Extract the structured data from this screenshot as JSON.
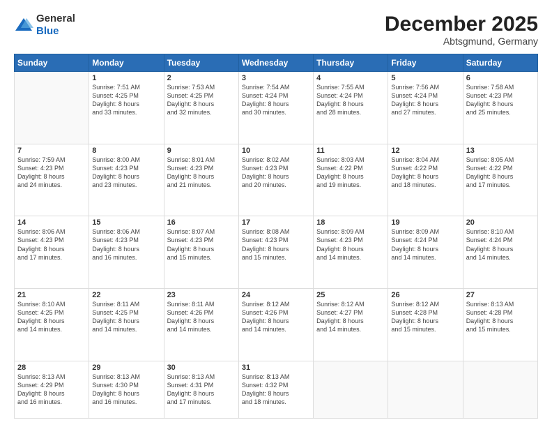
{
  "logo": {
    "general": "General",
    "blue": "Blue"
  },
  "header": {
    "month": "December 2025",
    "location": "Abtsgmund, Germany"
  },
  "days_of_week": [
    "Sunday",
    "Monday",
    "Tuesday",
    "Wednesday",
    "Thursday",
    "Friday",
    "Saturday"
  ],
  "weeks": [
    [
      {
        "day": "",
        "info": ""
      },
      {
        "day": "1",
        "info": "Sunrise: 7:51 AM\nSunset: 4:25 PM\nDaylight: 8 hours\nand 33 minutes."
      },
      {
        "day": "2",
        "info": "Sunrise: 7:53 AM\nSunset: 4:25 PM\nDaylight: 8 hours\nand 32 minutes."
      },
      {
        "day": "3",
        "info": "Sunrise: 7:54 AM\nSunset: 4:24 PM\nDaylight: 8 hours\nand 30 minutes."
      },
      {
        "day": "4",
        "info": "Sunrise: 7:55 AM\nSunset: 4:24 PM\nDaylight: 8 hours\nand 28 minutes."
      },
      {
        "day": "5",
        "info": "Sunrise: 7:56 AM\nSunset: 4:24 PM\nDaylight: 8 hours\nand 27 minutes."
      },
      {
        "day": "6",
        "info": "Sunrise: 7:58 AM\nSunset: 4:23 PM\nDaylight: 8 hours\nand 25 minutes."
      }
    ],
    [
      {
        "day": "7",
        "info": "Sunrise: 7:59 AM\nSunset: 4:23 PM\nDaylight: 8 hours\nand 24 minutes."
      },
      {
        "day": "8",
        "info": "Sunrise: 8:00 AM\nSunset: 4:23 PM\nDaylight: 8 hours\nand 23 minutes."
      },
      {
        "day": "9",
        "info": "Sunrise: 8:01 AM\nSunset: 4:23 PM\nDaylight: 8 hours\nand 21 minutes."
      },
      {
        "day": "10",
        "info": "Sunrise: 8:02 AM\nSunset: 4:23 PM\nDaylight: 8 hours\nand 20 minutes."
      },
      {
        "day": "11",
        "info": "Sunrise: 8:03 AM\nSunset: 4:22 PM\nDaylight: 8 hours\nand 19 minutes."
      },
      {
        "day": "12",
        "info": "Sunrise: 8:04 AM\nSunset: 4:22 PM\nDaylight: 8 hours\nand 18 minutes."
      },
      {
        "day": "13",
        "info": "Sunrise: 8:05 AM\nSunset: 4:22 PM\nDaylight: 8 hours\nand 17 minutes."
      }
    ],
    [
      {
        "day": "14",
        "info": "Sunrise: 8:06 AM\nSunset: 4:23 PM\nDaylight: 8 hours\nand 17 minutes."
      },
      {
        "day": "15",
        "info": "Sunrise: 8:06 AM\nSunset: 4:23 PM\nDaylight: 8 hours\nand 16 minutes."
      },
      {
        "day": "16",
        "info": "Sunrise: 8:07 AM\nSunset: 4:23 PM\nDaylight: 8 hours\nand 15 minutes."
      },
      {
        "day": "17",
        "info": "Sunrise: 8:08 AM\nSunset: 4:23 PM\nDaylight: 8 hours\nand 15 minutes."
      },
      {
        "day": "18",
        "info": "Sunrise: 8:09 AM\nSunset: 4:23 PM\nDaylight: 8 hours\nand 14 minutes."
      },
      {
        "day": "19",
        "info": "Sunrise: 8:09 AM\nSunset: 4:24 PM\nDaylight: 8 hours\nand 14 minutes."
      },
      {
        "day": "20",
        "info": "Sunrise: 8:10 AM\nSunset: 4:24 PM\nDaylight: 8 hours\nand 14 minutes."
      }
    ],
    [
      {
        "day": "21",
        "info": "Sunrise: 8:10 AM\nSunset: 4:25 PM\nDaylight: 8 hours\nand 14 minutes."
      },
      {
        "day": "22",
        "info": "Sunrise: 8:11 AM\nSunset: 4:25 PM\nDaylight: 8 hours\nand 14 minutes."
      },
      {
        "day": "23",
        "info": "Sunrise: 8:11 AM\nSunset: 4:26 PM\nDaylight: 8 hours\nand 14 minutes."
      },
      {
        "day": "24",
        "info": "Sunrise: 8:12 AM\nSunset: 4:26 PM\nDaylight: 8 hours\nand 14 minutes."
      },
      {
        "day": "25",
        "info": "Sunrise: 8:12 AM\nSunset: 4:27 PM\nDaylight: 8 hours\nand 14 minutes."
      },
      {
        "day": "26",
        "info": "Sunrise: 8:12 AM\nSunset: 4:28 PM\nDaylight: 8 hours\nand 15 minutes."
      },
      {
        "day": "27",
        "info": "Sunrise: 8:13 AM\nSunset: 4:28 PM\nDaylight: 8 hours\nand 15 minutes."
      }
    ],
    [
      {
        "day": "28",
        "info": "Sunrise: 8:13 AM\nSunset: 4:29 PM\nDaylight: 8 hours\nand 16 minutes."
      },
      {
        "day": "29",
        "info": "Sunrise: 8:13 AM\nSunset: 4:30 PM\nDaylight: 8 hours\nand 16 minutes."
      },
      {
        "day": "30",
        "info": "Sunrise: 8:13 AM\nSunset: 4:31 PM\nDaylight: 8 hours\nand 17 minutes."
      },
      {
        "day": "31",
        "info": "Sunrise: 8:13 AM\nSunset: 4:32 PM\nDaylight: 8 hours\nand 18 minutes."
      },
      {
        "day": "",
        "info": ""
      },
      {
        "day": "",
        "info": ""
      },
      {
        "day": "",
        "info": ""
      }
    ]
  ]
}
